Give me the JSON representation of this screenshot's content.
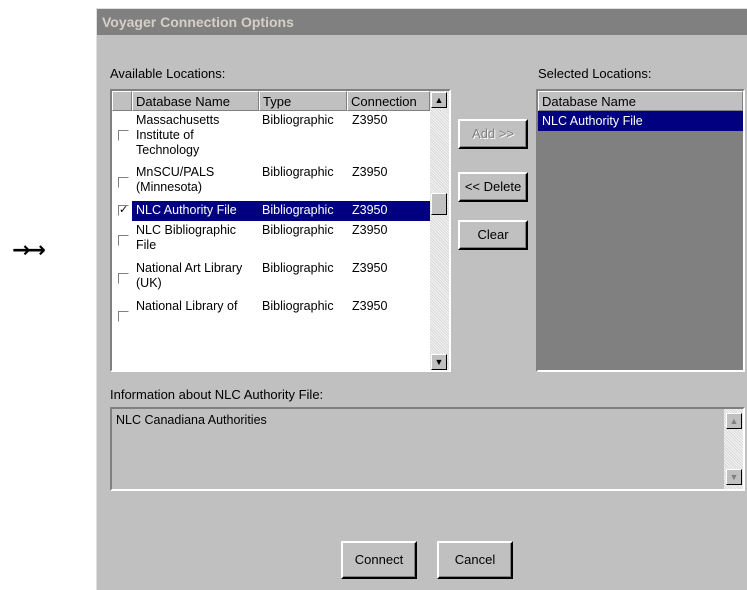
{
  "arrows": "→→",
  "dialog": {
    "title": "Voyager Connection Options",
    "available_label": "Available Locations:",
    "selected_label": "Selected Locations:",
    "info_label": "Information about NLC Authority File:",
    "info_text": "NLC Canadiana Authorities",
    "columns": {
      "name": "Database Name",
      "type": "Type",
      "connection": "Connection"
    },
    "rows": [
      {
        "name": "Massachusetts Institute of Technology",
        "type": "Bibliographic",
        "connection": "Z3950",
        "checked": false
      },
      {
        "name": "MnSCU/PALS (Minnesota)",
        "type": "Bibliographic",
        "connection": "Z3950",
        "checked": false
      },
      {
        "name": "NLC Authority File",
        "type": "Bibliographic",
        "connection": "Z3950",
        "checked": true,
        "selected": true
      },
      {
        "name": "NLC Bibliographic File",
        "type": "Bibliographic",
        "connection": "Z3950",
        "checked": false
      },
      {
        "name": "National Art Library (UK)",
        "type": "Bibliographic",
        "connection": "Z3950",
        "checked": false
      },
      {
        "name": "National Library of",
        "type": "Bibliographic",
        "connection": "Z3950",
        "checked": false
      }
    ],
    "selected_column": "Database Name",
    "selected_items": [
      "NLC Authority File"
    ],
    "buttons": {
      "add": "Add >>",
      "delete": "<< Delete",
      "clear": "Clear",
      "connect": "Connect",
      "cancel": "Cancel"
    }
  }
}
